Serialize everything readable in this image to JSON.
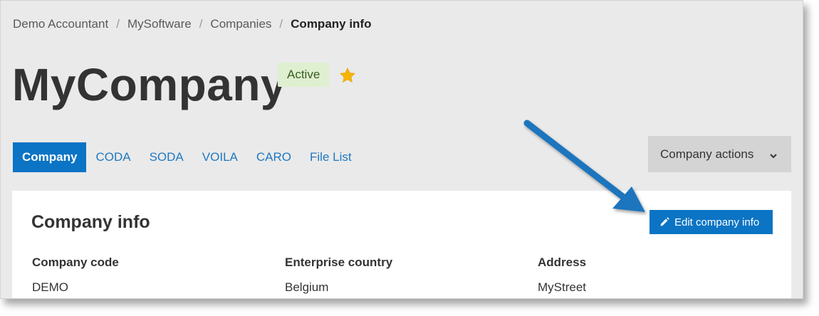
{
  "breadcrumb": {
    "items": [
      "Demo Accountant",
      "MySoftware",
      "Companies"
    ],
    "separator": "/",
    "current": "Company info"
  },
  "page": {
    "title": "MyCompany",
    "status": "Active",
    "favorite_icon": "star-icon"
  },
  "tabs": [
    {
      "label": "Company",
      "active": true
    },
    {
      "label": "CODA",
      "active": false
    },
    {
      "label": "SODA",
      "active": false
    },
    {
      "label": "VOILA",
      "active": false
    },
    {
      "label": "CARO",
      "active": false
    },
    {
      "label": "File List",
      "active": false
    }
  ],
  "actions": {
    "label": "Company actions",
    "icon": "chevron-down-icon"
  },
  "card": {
    "title": "Company info",
    "edit_label": "Edit company info",
    "edit_icon": "pencil-icon",
    "fields": [
      {
        "label": "Company code",
        "value": "DEMO"
      },
      {
        "label": "Enterprise country",
        "value": "Belgium"
      },
      {
        "label": "Address",
        "value": "MyStreet"
      }
    ]
  },
  "colors": {
    "accent": "#0b74c4",
    "link": "#1f78c1",
    "badge_bg": "#dff0d0",
    "star": "#f5b400",
    "background": "#eaeaea",
    "annotation_arrow": "#1a74bd"
  }
}
